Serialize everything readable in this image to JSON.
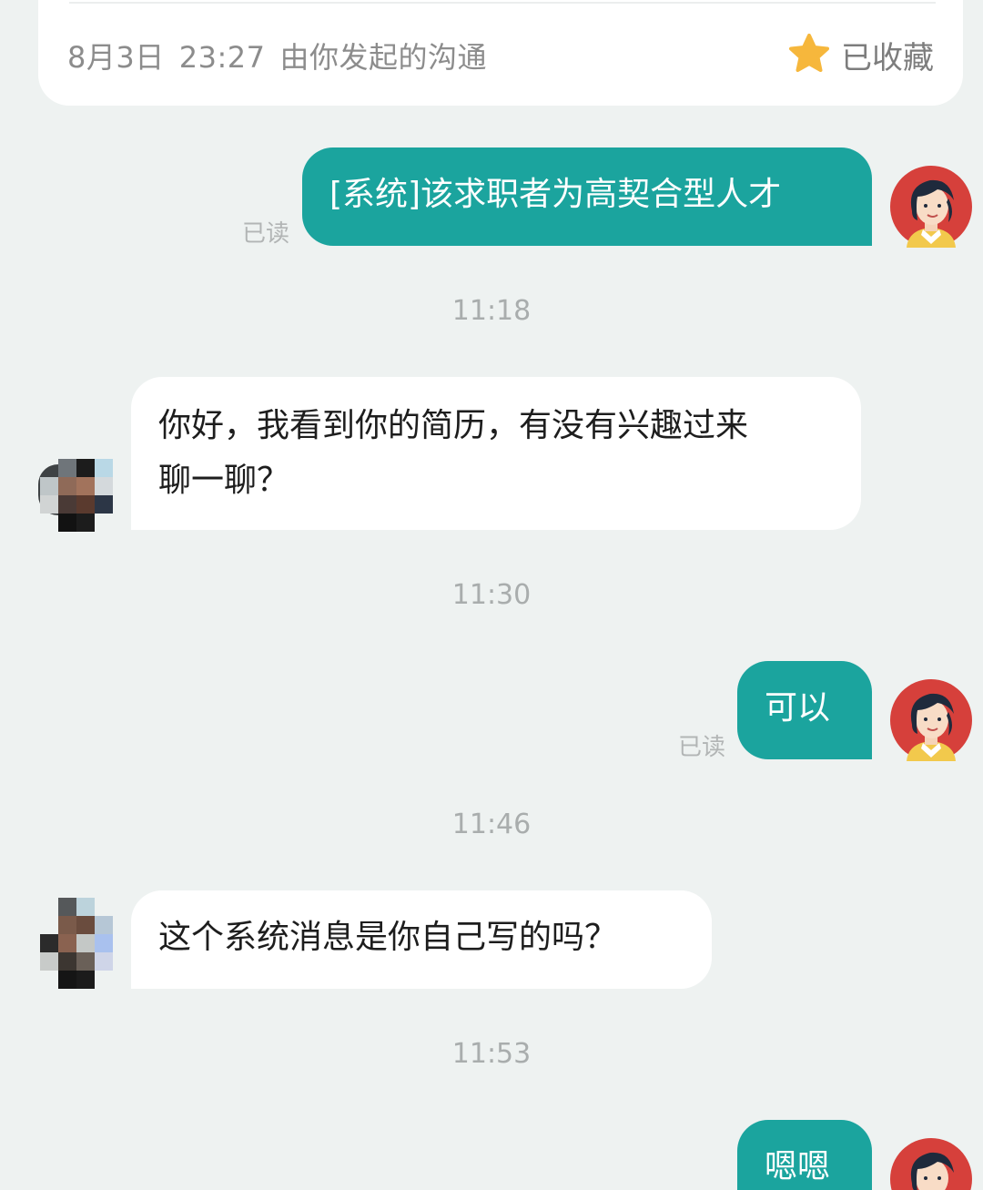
{
  "header": {
    "date": "8月3日",
    "time": "23:27",
    "description": "由你发起的沟通",
    "favorite_label": "已收藏",
    "favorite_icon": "star-icon",
    "star_color": "#f6b73c"
  },
  "colors": {
    "self_bubble": "#1ba49e",
    "other_bubble": "#ffffff",
    "background": "#eef2f1"
  },
  "messages": [
    {
      "sender": "self",
      "text": "[系统]该求职者为高契合型人才",
      "read_status": "已读"
    },
    {
      "timestamp": "11:18"
    },
    {
      "sender": "other",
      "lines": [
        "你好，我看到你的简历，有没有兴趣过来",
        "聊一聊？"
      ]
    },
    {
      "timestamp": "11:30"
    },
    {
      "sender": "self",
      "text": "可以",
      "read_status": "已读"
    },
    {
      "timestamp": "11:46"
    },
    {
      "sender": "other",
      "text": "这个系统消息是你自己写的吗？"
    },
    {
      "timestamp": "11:53"
    },
    {
      "sender": "self",
      "text": "嗯嗯"
    }
  ]
}
